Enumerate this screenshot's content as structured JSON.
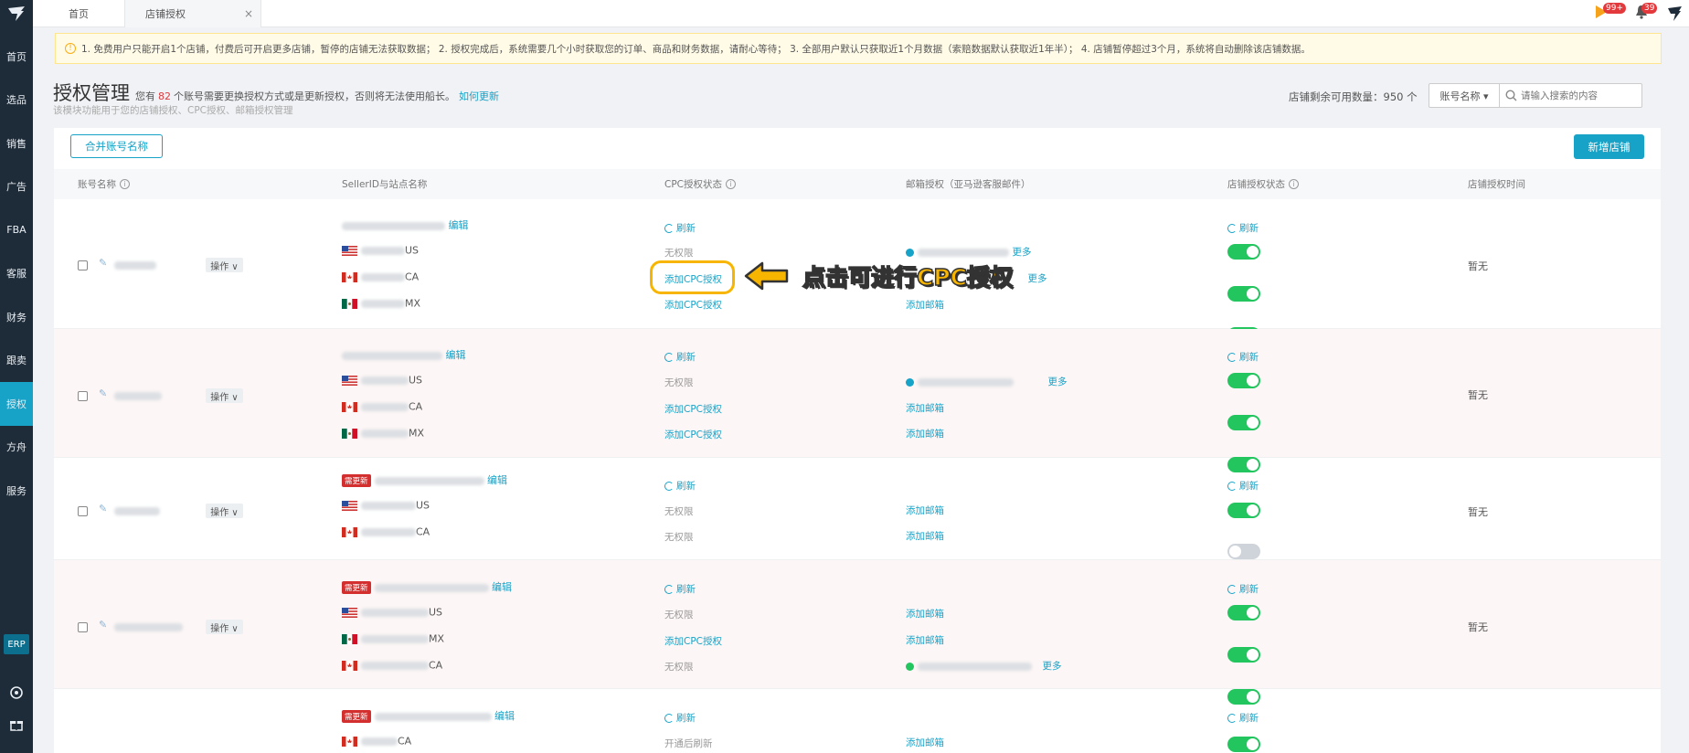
{
  "tabs": {
    "home": "首页",
    "auth": "店铺授权"
  },
  "badges": {
    "flag": "99+",
    "bell": "39"
  },
  "sidebar": {
    "items": [
      {
        "label": "首页"
      },
      {
        "label": "选品"
      },
      {
        "label": "销售"
      },
      {
        "label": "广告"
      },
      {
        "label": "FBA"
      },
      {
        "label": "客服"
      },
      {
        "label": "财务"
      },
      {
        "label": "跟卖"
      },
      {
        "label": "授权"
      },
      {
        "label": "方舟"
      },
      {
        "label": "服务"
      }
    ],
    "erp": "ERP"
  },
  "notice": "1. 免费用户只能开启1个店铺，付费后可开启更多店铺，暂停的店铺无法获取数据； 2. 授权完成后，系统需要几个小时获取您的订单、商品和财务数据，请耐心等待； 3. 全部用户默认只获取近1个月数据（索赔数据默认获取近1年半）； 4. 店铺暂停超过3个月，系统将自动删除该店铺数据。",
  "header": {
    "title": "授权管理",
    "desc_pre": "您有",
    "count": "82",
    "desc_post": "个账号需要更换授权方式或是更新授权，否则将无法使用船长。",
    "how_link": "如何更新",
    "subtitle": "该模块功能用于您的店铺授权、CPC授权、邮箱授权管理",
    "remaining": "店铺剩余可用数量：950 个",
    "select_label": "账号名称 ▾",
    "search_placeholder": "请输入搜索的内容"
  },
  "buttons": {
    "merge": "合并账号名称",
    "add_store": "新增店铺"
  },
  "columns": {
    "account": "账号名称",
    "seller": "SellerID与站点名称",
    "cpc": "CPC授权状态",
    "email": "邮箱授权（亚马逊客服邮件）",
    "store_status": "店铺授权状态",
    "store_time": "店铺授权时间"
  },
  "labels": {
    "op": "操作 ∨",
    "edit": "编辑",
    "refresh": "刷新",
    "no_perm": "无权限",
    "add_cpc": "添加CPC授权",
    "add_email": "添加邮箱",
    "more": "更多",
    "none": "暂无",
    "new_tag": "需更新",
    "open_fail": "开通后刷新"
  },
  "sites": {
    "US": "US",
    "CA": "CA",
    "MX": "MX"
  },
  "colors": {
    "accent": "#17a2c7",
    "on": "#22c55e",
    "highlight": "#f7b500"
  },
  "callout": {
    "text": "点击可进行CPC授权"
  }
}
